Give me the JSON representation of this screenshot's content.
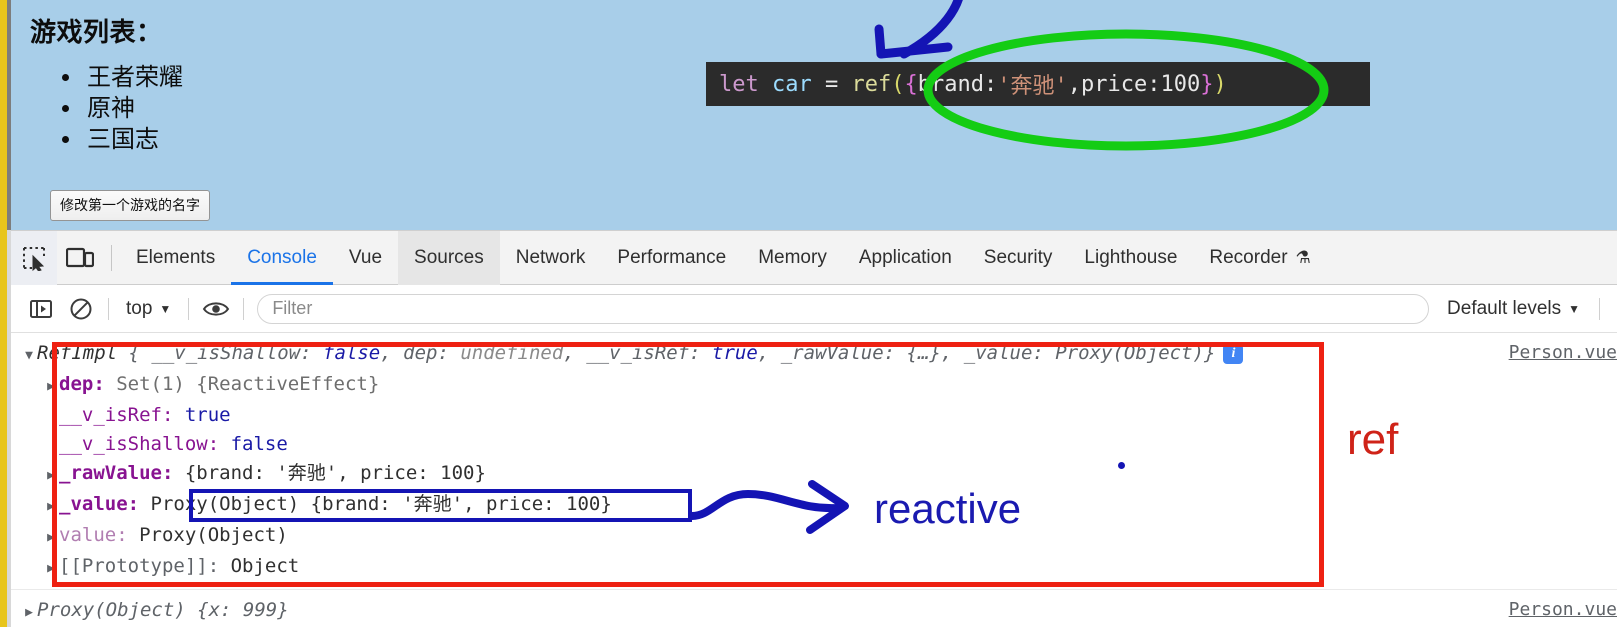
{
  "page": {
    "title": "游戏列表：",
    "games": [
      "王者荣耀",
      "原神",
      "三国志"
    ],
    "button_label": "修改第一个游戏的名字"
  },
  "code_snippet": {
    "full": "let car = ref({brand:'奔驰',price:100})",
    "kw": "let",
    "var": "car",
    "op": "=",
    "fn": "ref",
    "open_paren": "(",
    "open_brace": "{",
    "key1": "brand:",
    "str1": "'奔驰'",
    "comma": ",",
    "key2": "price:",
    "num1": "100",
    "close_brace": "}",
    "close_paren": ")"
  },
  "devtools": {
    "icons": {
      "inspect": "inspect-element-icon",
      "device": "device-toolbar-icon"
    },
    "tabs": [
      {
        "label": "Elements",
        "state": "normal"
      },
      {
        "label": "Console",
        "state": "active"
      },
      {
        "label": "Vue",
        "state": "normal"
      },
      {
        "label": "Sources",
        "state": "hover"
      },
      {
        "label": "Network",
        "state": "normal"
      },
      {
        "label": "Performance",
        "state": "normal"
      },
      {
        "label": "Memory",
        "state": "normal"
      },
      {
        "label": "Application",
        "state": "normal"
      },
      {
        "label": "Security",
        "state": "normal"
      },
      {
        "label": "Lighthouse",
        "state": "normal"
      },
      {
        "label": "Recorder",
        "state": "normal",
        "badge": "⚗"
      }
    ],
    "console_toolbar": {
      "sidebar_icon": "console-sidebar-icon",
      "clear_icon": "clear-console-icon",
      "context": "top",
      "context_caret": "▼",
      "eye_icon": "live-expression-eye-icon",
      "filter_placeholder": "Filter",
      "filter_value": "",
      "levels": "Default levels",
      "levels_caret": "▼"
    },
    "console": {
      "message1": {
        "triangle": "▼",
        "classname": "RefImpl",
        "open": " {",
        "p1_key": "__v_isShallow:",
        "p1_val": "false",
        "p2_key": "dep:",
        "p2_val": "undefined",
        "p3_key": "__v_isRef:",
        "p3_val": "true",
        "p4_key": "_rawValue:",
        "p4_val": "{…}",
        "p5_key": "_value:",
        "p5_val": "Proxy(Object)",
        "close": "}",
        "info_badge": "i",
        "source": "Person.vue",
        "rows": [
          {
            "tri": "▶",
            "key": "dep:",
            "kind": "bold",
            "value": "Set(1) {ReactiveEffect}"
          },
          {
            "tri": "",
            "key": "__v_isRef:",
            "kind": "plain",
            "value": "true",
            "vtype": "bool"
          },
          {
            "tri": "",
            "key": "__v_isShallow:",
            "kind": "plain",
            "value": "false",
            "vtype": "bool"
          },
          {
            "tri": "▶",
            "key": "_rawValue:",
            "kind": "bold",
            "value": "{brand: '奔驰', price: 100}"
          },
          {
            "tri": "▶",
            "key": "_value:",
            "kind": "bold",
            "value": "Proxy(Object) {brand: '奔驰', price: 100}"
          },
          {
            "tri": "▶",
            "key": "value:",
            "kind": "getter",
            "value": "Proxy(Object)"
          },
          {
            "tri": "▶",
            "key": "[[Prototype]]:",
            "kind": "proto",
            "value": "Object"
          }
        ]
      },
      "message2": {
        "triangle": "▶",
        "text": "Proxy(Object) {x: 999}",
        "source": "Person.vue"
      }
    }
  },
  "annotations": {
    "red_label": "ref",
    "blue_label": "reactive",
    "red_color": "#ee2112",
    "blue_color": "#1414b4",
    "green_color": "#14cc14",
    "arrow_blue": "blue-arrow-annotation",
    "arrow_reactive": "blue-arrow-to-reactive",
    "green_ellipse": "green-ellipse-annotation"
  }
}
